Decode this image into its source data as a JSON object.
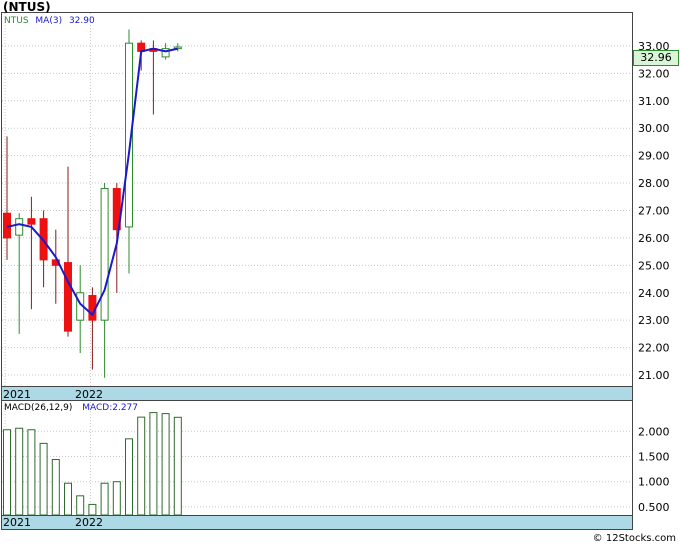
{
  "title": "(NTUS)",
  "watermark": "© 12Stocks.com",
  "price_tag": "32.96",
  "legend": {
    "ticker": "NTUS",
    "ma_label": "MA(3)",
    "ma_value": "32.90"
  },
  "macd_legend": {
    "label": "MACD(26,12,9)",
    "value_label": "MACD:2.277"
  },
  "date_labels": [
    "2021",
    "2022"
  ],
  "colors": {
    "up": "#2e8b2e",
    "down": "#ee1111",
    "ma": "#1a1acc",
    "axis_band": "#add8e6",
    "macd_bar": "#2e6b2e",
    "price_tag_bg": "#d8f5d8"
  },
  "chart_data": [
    {
      "type": "candlestick",
      "ylim": [
        20.6,
        34.2
      ],
      "yticks": [
        21,
        22,
        23,
        24,
        25,
        26,
        27,
        28,
        29,
        30,
        31,
        32,
        33
      ],
      "ytick_labels": [
        "21.00",
        "22.00",
        "23.00",
        "24.00",
        "25.00",
        "26.00",
        "27.00",
        "28.00",
        "29.00",
        "30.00",
        "31.00",
        "32.00",
        "33.00"
      ],
      "candles": [
        {
          "o": 26.9,
          "h": 29.7,
          "l": 25.2,
          "c": 26.0
        },
        {
          "o": 26.1,
          "h": 26.9,
          "l": 22.5,
          "c": 26.7
        },
        {
          "o": 26.7,
          "h": 27.5,
          "l": 23.4,
          "c": 26.5
        },
        {
          "o": 26.7,
          "h": 27.0,
          "l": 24.2,
          "c": 25.2
        },
        {
          "o": 25.2,
          "h": 26.3,
          "l": 23.6,
          "c": 25.0
        },
        {
          "o": 25.1,
          "h": 28.6,
          "l": 22.4,
          "c": 22.6
        },
        {
          "o": 23.0,
          "h": 25.0,
          "l": 21.8,
          "c": 24.0
        },
        {
          "o": 23.9,
          "h": 24.2,
          "l": 21.2,
          "c": 23.0
        },
        {
          "o": 23.0,
          "h": 28.0,
          "l": 20.9,
          "c": 27.8
        },
        {
          "o": 27.8,
          "h": 28.0,
          "l": 24.0,
          "c": 26.3
        },
        {
          "o": 26.4,
          "h": 33.6,
          "l": 24.7,
          "c": 33.1
        },
        {
          "o": 33.1,
          "h": 33.2,
          "l": 32.1,
          "c": 32.8
        },
        {
          "o": 32.9,
          "h": 33.2,
          "l": 30.5,
          "c": 32.8
        },
        {
          "o": 32.6,
          "h": 33.1,
          "l": 32.5,
          "c": 32.9
        },
        {
          "o": 32.9,
          "h": 33.1,
          "l": 32.8,
          "c": 32.96
        }
      ],
      "ma3": [
        26.4,
        26.5,
        26.4,
        25.9,
        25.3,
        24.4,
        23.6,
        23.2,
        24.1,
        25.8,
        29.1,
        32.8,
        32.9,
        32.8,
        32.9
      ],
      "date_ticks": [
        {
          "label": "2021",
          "index": 0
        },
        {
          "label": "2022",
          "index": 7
        }
      ]
    },
    {
      "type": "bar",
      "name": "MACD(26,12,9)",
      "ylim": [
        0.34,
        2.58
      ],
      "yticks": [
        0.5,
        1.0,
        1.5,
        2.0
      ],
      "ytick_labels": [
        "0.500",
        "1.000",
        "1.500",
        "2.000"
      ],
      "values": [
        2.03,
        2.06,
        2.03,
        1.76,
        1.44,
        0.97,
        0.72,
        0.55,
        0.97,
        1.0,
        1.85,
        2.28,
        2.37,
        2.35,
        2.277
      ]
    }
  ]
}
